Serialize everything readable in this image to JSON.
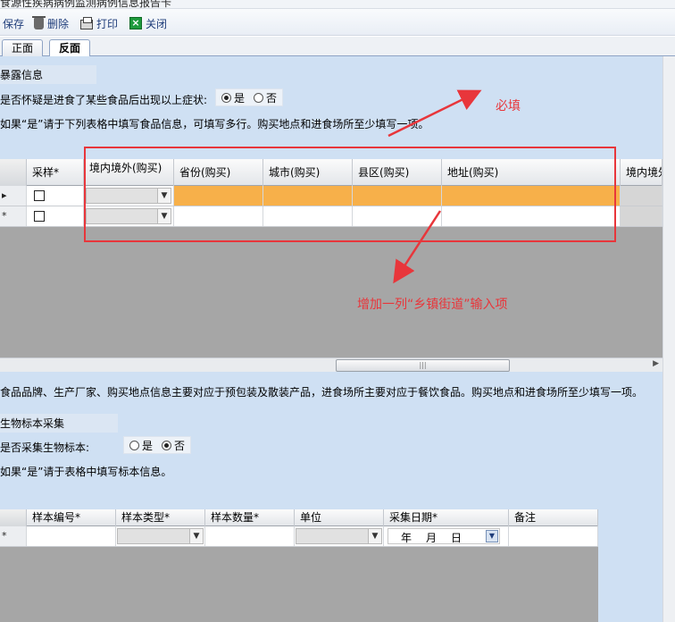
{
  "window": {
    "title": "食源性疾病病例监测病例信息报告卡"
  },
  "toolbar": {
    "save": "保存",
    "delete": "删除",
    "print": "打印",
    "close": "关闭"
  },
  "tabs": [
    {
      "label": "正面",
      "active": false
    },
    {
      "label": "反面",
      "active": true
    }
  ],
  "exposure": {
    "title": "暴露信息",
    "question": "是否怀疑是进食了某些食品后出现以上症状:",
    "options": {
      "yes": "是",
      "no": "否"
    },
    "selected": "是",
    "hint": "如果“是”请于下列表格中填写食品信息，可填写多行。购买地点和进食场所至少填写一项。",
    "grid": {
      "headers": [
        "采样*",
        "境内境外(购买)",
        "省份(购买)",
        "城市(购买)",
        "县区(购买)",
        "地址(购买)",
        "境内境外"
      ],
      "row_markers": [
        "▸",
        "*"
      ]
    },
    "footnote": "食品品牌、生产厂家、购买地点信息主要对应于预包装及散装产品，进食场所主要对应于餐饮食品。购买地点和进食场所至少填写一项。"
  },
  "specimen": {
    "title": "生物标本采集",
    "question": "是否采集生物标本:",
    "options": {
      "yes": "是",
      "no": "否"
    },
    "selected": "否",
    "hint": "如果“是”请于表格中填写标本信息。",
    "grid": {
      "headers": [
        "样本编号*",
        "样本类型*",
        "样本数量*",
        "单位",
        "采集日期*",
        "备注"
      ],
      "row_marker": "*",
      "date_placeholder": {
        "year": "年",
        "month": "月",
        "day": "日"
      }
    }
  },
  "annotations": {
    "required": "必填",
    "add_column": "增加一列“乡镇街道”输入项"
  },
  "colors": {
    "annotation": "#e8363b",
    "selected_row": "#f7b04a",
    "panel": "#cfe0f3",
    "grid_empty": "#a6a6a6"
  }
}
